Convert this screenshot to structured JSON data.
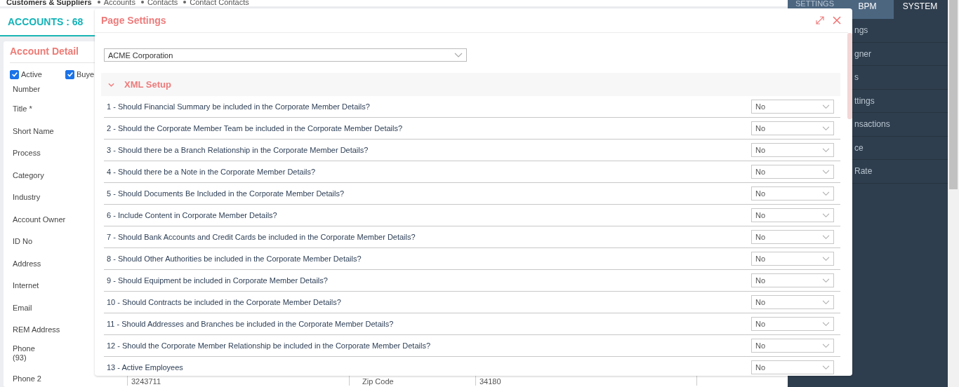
{
  "breadcrumb": [
    {
      "label": "Customers & Suppliers",
      "current": true
    },
    {
      "label": "Accounts",
      "current": false
    },
    {
      "label": "Contacts",
      "current": false
    },
    {
      "label": "Contact Contacts",
      "current": false
    }
  ],
  "accounts_title": "ACCOUNTS : 68",
  "account_detail": {
    "title": "Account Detail",
    "checkboxes": [
      {
        "label": "Active",
        "checked": true
      },
      {
        "label": "Buye",
        "checked": true
      }
    ],
    "fields": [
      {
        "label": "Number"
      },
      {
        "label": "Title *"
      },
      {
        "label": "Short Name"
      },
      {
        "label": "Process"
      },
      {
        "label": "Category"
      },
      {
        "label": "Industry"
      },
      {
        "label": "Account Owner"
      },
      {
        "label": "ID No"
      },
      {
        "label": "Address"
      },
      {
        "label": "Internet"
      },
      {
        "label": "Email"
      },
      {
        "label": "REM Address"
      },
      {
        "label": "Phone",
        "sublabel": "(93)"
      },
      {
        "label": "Phone 2",
        "value": "3243711",
        "column_3": "Zip Code",
        "column_4": "34180"
      }
    ]
  },
  "sidebar": {
    "tabs": [
      {
        "label": "SETTINGS",
        "selected": false
      },
      {
        "label": "BPM",
        "selected": false
      },
      {
        "label": "SYSTEM",
        "selected": true
      }
    ],
    "items": [
      {
        "label": "ngs"
      },
      {
        "label": "gner"
      },
      {
        "label": "s"
      },
      {
        "label": "ttings"
      },
      {
        "label": "nsactions"
      },
      {
        "label": "ce"
      },
      {
        "label": "Rate"
      }
    ]
  },
  "modal": {
    "title": "Page Settings",
    "company": "ACME Corporation",
    "section": {
      "title": "XML Setup",
      "expanded": true
    },
    "questions": [
      {
        "text": "1 - Should Financial Summary be included in the Corporate Member Details?",
        "value": "No"
      },
      {
        "text": "2 - Should the Corporate Member Team be included in the Corporate Member Details?",
        "value": "No"
      },
      {
        "text": "3 - Should there be a Branch Relationship in the Corporate Member Details?",
        "value": "No"
      },
      {
        "text": "4 - Should there be a Note in the Corporate Member Details?",
        "value": "No"
      },
      {
        "text": "5 - Should Documents Be Included in the Corporate Member Details?",
        "value": "No"
      },
      {
        "text": "6 - Include Content in Corporate Member Details?",
        "value": "No"
      },
      {
        "text": "7 - Should Bank Accounts and Credit Cards be included in the Corporate Member Details?",
        "value": "No"
      },
      {
        "text": "8 - Should Other Authorities be included in the Corporate Member Details?",
        "value": "No"
      },
      {
        "text": "9 - Should Equipment be included in Corporate Member Details?",
        "value": "No"
      },
      {
        "text": "10 - Should Contracts be included in the Corporate Member Details?",
        "value": "No"
      },
      {
        "text": "11 - Should Addresses and Branches be included in the Corporate Member Details?",
        "value": "No"
      },
      {
        "text": "12 - Should the Corporate Member Relationship be included in the Corporate Member Details?",
        "value": "No"
      },
      {
        "text": "13 - Active Employees",
        "value": "No"
      }
    ]
  }
}
